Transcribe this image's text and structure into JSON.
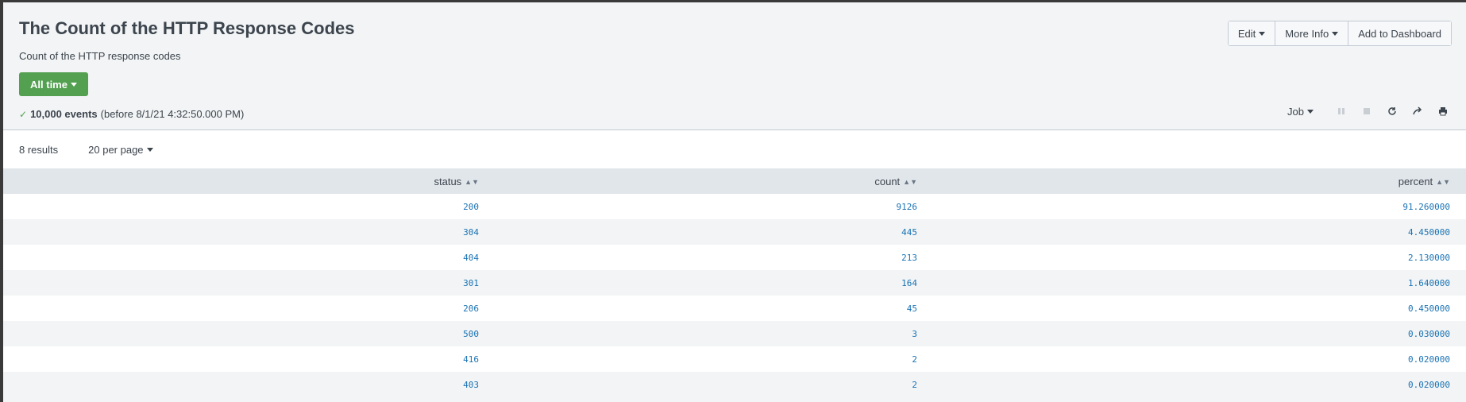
{
  "header": {
    "title": "The Count of the HTTP Response Codes",
    "subtitle": "Count of the HTTP response codes"
  },
  "time_picker": {
    "label": "All time"
  },
  "status": {
    "count": "10,000 events",
    "detail": "(before 8/1/21 4:32:50.000 PM)"
  },
  "actions": {
    "edit": "Edit",
    "more_info": "More Info",
    "add_to_dashboard": "Add to Dashboard"
  },
  "job": {
    "label": "Job"
  },
  "results": {
    "count_label": "8 results",
    "per_page": "20 per page"
  },
  "table": {
    "columns": [
      "status",
      "count",
      "percent"
    ],
    "rows": [
      [
        "200",
        "9126",
        "91.260000"
      ],
      [
        "304",
        "445",
        "4.450000"
      ],
      [
        "404",
        "213",
        "2.130000"
      ],
      [
        "301",
        "164",
        "1.640000"
      ],
      [
        "206",
        "45",
        "0.450000"
      ],
      [
        "500",
        "3",
        "0.030000"
      ],
      [
        "416",
        "2",
        "0.020000"
      ],
      [
        "403",
        "2",
        "0.020000"
      ]
    ]
  },
  "colors": {
    "accent_green": "#53a051",
    "link_blue": "#1a73b5",
    "header_bg": "#e1e6eb"
  }
}
